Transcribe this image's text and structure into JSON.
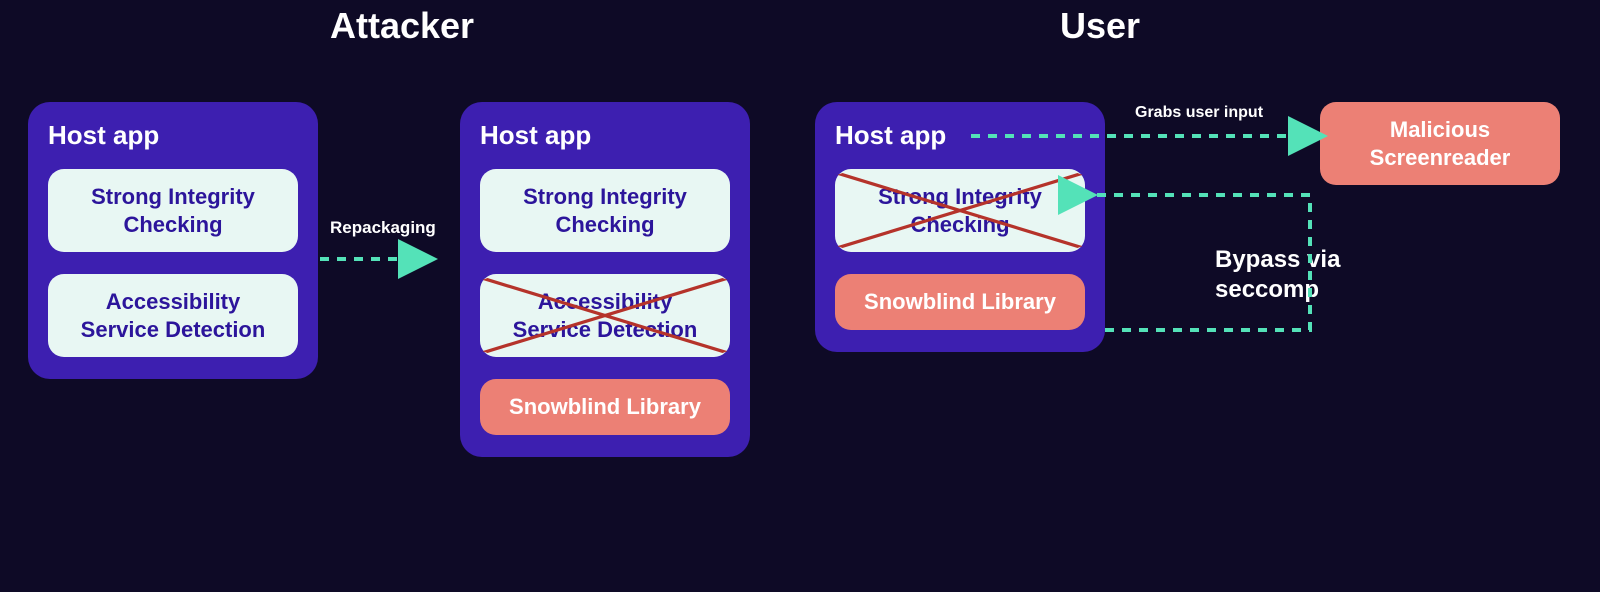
{
  "sections": {
    "attacker": "Attacker",
    "user": "User"
  },
  "panels": {
    "attacker_before": {
      "title": "Host app",
      "integrity": "Strong Integrity Checking",
      "accessibility": "Accessibility Service Detection"
    },
    "attacker_after": {
      "title": "Host app",
      "integrity": "Strong Integrity Checking",
      "accessibility": "Accessibility Service Detection",
      "snowblind": "Snowblind Library"
    },
    "user": {
      "title": "Host app",
      "integrity": "Strong Integrity Checking",
      "snowblind": "Snowblind Library"
    }
  },
  "labels": {
    "repackaging": "Repackaging",
    "grabs_input": "Grabs user input",
    "bypass_line1": "Bypass via",
    "bypass_line2": "seccomp"
  },
  "malicious": "Malicious Screenreader"
}
